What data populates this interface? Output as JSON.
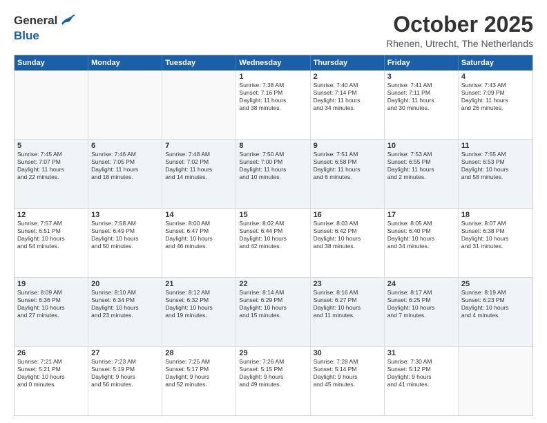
{
  "header": {
    "logo_line1": "General",
    "logo_line2": "Blue",
    "month": "October 2025",
    "location": "Rhenen, Utrecht, The Netherlands"
  },
  "weekdays": [
    "Sunday",
    "Monday",
    "Tuesday",
    "Wednesday",
    "Thursday",
    "Friday",
    "Saturday"
  ],
  "rows": [
    [
      {
        "day": "",
        "text": ""
      },
      {
        "day": "",
        "text": ""
      },
      {
        "day": "",
        "text": ""
      },
      {
        "day": "1",
        "text": "Sunrise: 7:38 AM\nSunset: 7:16 PM\nDaylight: 11 hours\nand 38 minutes."
      },
      {
        "day": "2",
        "text": "Sunrise: 7:40 AM\nSunset: 7:14 PM\nDaylight: 11 hours\nand 34 minutes."
      },
      {
        "day": "3",
        "text": "Sunrise: 7:41 AM\nSunset: 7:11 PM\nDaylight: 11 hours\nand 30 minutes."
      },
      {
        "day": "4",
        "text": "Sunrise: 7:43 AM\nSunset: 7:09 PM\nDaylight: 11 hours\nand 26 minutes."
      }
    ],
    [
      {
        "day": "5",
        "text": "Sunrise: 7:45 AM\nSunset: 7:07 PM\nDaylight: 11 hours\nand 22 minutes."
      },
      {
        "day": "6",
        "text": "Sunrise: 7:46 AM\nSunset: 7:05 PM\nDaylight: 11 hours\nand 18 minutes."
      },
      {
        "day": "7",
        "text": "Sunrise: 7:48 AM\nSunset: 7:02 PM\nDaylight: 11 hours\nand 14 minutes."
      },
      {
        "day": "8",
        "text": "Sunrise: 7:50 AM\nSunset: 7:00 PM\nDaylight: 11 hours\nand 10 minutes."
      },
      {
        "day": "9",
        "text": "Sunrise: 7:51 AM\nSunset: 6:58 PM\nDaylight: 11 hours\nand 6 minutes."
      },
      {
        "day": "10",
        "text": "Sunrise: 7:53 AM\nSunset: 6:55 PM\nDaylight: 11 hours\nand 2 minutes."
      },
      {
        "day": "11",
        "text": "Sunrise: 7:55 AM\nSunset: 6:53 PM\nDaylight: 10 hours\nand 58 minutes."
      }
    ],
    [
      {
        "day": "12",
        "text": "Sunrise: 7:57 AM\nSunset: 6:51 PM\nDaylight: 10 hours\nand 54 minutes."
      },
      {
        "day": "13",
        "text": "Sunrise: 7:58 AM\nSunset: 6:49 PM\nDaylight: 10 hours\nand 50 minutes."
      },
      {
        "day": "14",
        "text": "Sunrise: 8:00 AM\nSunset: 6:47 PM\nDaylight: 10 hours\nand 46 minutes."
      },
      {
        "day": "15",
        "text": "Sunrise: 8:02 AM\nSunset: 6:44 PM\nDaylight: 10 hours\nand 42 minutes."
      },
      {
        "day": "16",
        "text": "Sunrise: 8:03 AM\nSunset: 6:42 PM\nDaylight: 10 hours\nand 38 minutes."
      },
      {
        "day": "17",
        "text": "Sunrise: 8:05 AM\nSunset: 6:40 PM\nDaylight: 10 hours\nand 34 minutes."
      },
      {
        "day": "18",
        "text": "Sunrise: 8:07 AM\nSunset: 6:38 PM\nDaylight: 10 hours\nand 31 minutes."
      }
    ],
    [
      {
        "day": "19",
        "text": "Sunrise: 8:09 AM\nSunset: 6:36 PM\nDaylight: 10 hours\nand 27 minutes."
      },
      {
        "day": "20",
        "text": "Sunrise: 8:10 AM\nSunset: 6:34 PM\nDaylight: 10 hours\nand 23 minutes."
      },
      {
        "day": "21",
        "text": "Sunrise: 8:12 AM\nSunset: 6:32 PM\nDaylight: 10 hours\nand 19 minutes."
      },
      {
        "day": "22",
        "text": "Sunrise: 8:14 AM\nSunset: 6:29 PM\nDaylight: 10 hours\nand 15 minutes."
      },
      {
        "day": "23",
        "text": "Sunrise: 8:16 AM\nSunset: 6:27 PM\nDaylight: 10 hours\nand 11 minutes."
      },
      {
        "day": "24",
        "text": "Sunrise: 8:17 AM\nSunset: 6:25 PM\nDaylight: 10 hours\nand 7 minutes."
      },
      {
        "day": "25",
        "text": "Sunrise: 8:19 AM\nSunset: 6:23 PM\nDaylight: 10 hours\nand 4 minutes."
      }
    ],
    [
      {
        "day": "26",
        "text": "Sunrise: 7:21 AM\nSunset: 5:21 PM\nDaylight: 10 hours\nand 0 minutes."
      },
      {
        "day": "27",
        "text": "Sunrise: 7:23 AM\nSunset: 5:19 PM\nDaylight: 9 hours\nand 56 minutes."
      },
      {
        "day": "28",
        "text": "Sunrise: 7:25 AM\nSunset: 5:17 PM\nDaylight: 9 hours\nand 52 minutes."
      },
      {
        "day": "29",
        "text": "Sunrise: 7:26 AM\nSunset: 5:15 PM\nDaylight: 9 hours\nand 49 minutes."
      },
      {
        "day": "30",
        "text": "Sunrise: 7:28 AM\nSunset: 5:14 PM\nDaylight: 9 hours\nand 45 minutes."
      },
      {
        "day": "31",
        "text": "Sunrise: 7:30 AM\nSunset: 5:12 PM\nDaylight: 9 hours\nand 41 minutes."
      },
      {
        "day": "",
        "text": ""
      }
    ]
  ]
}
